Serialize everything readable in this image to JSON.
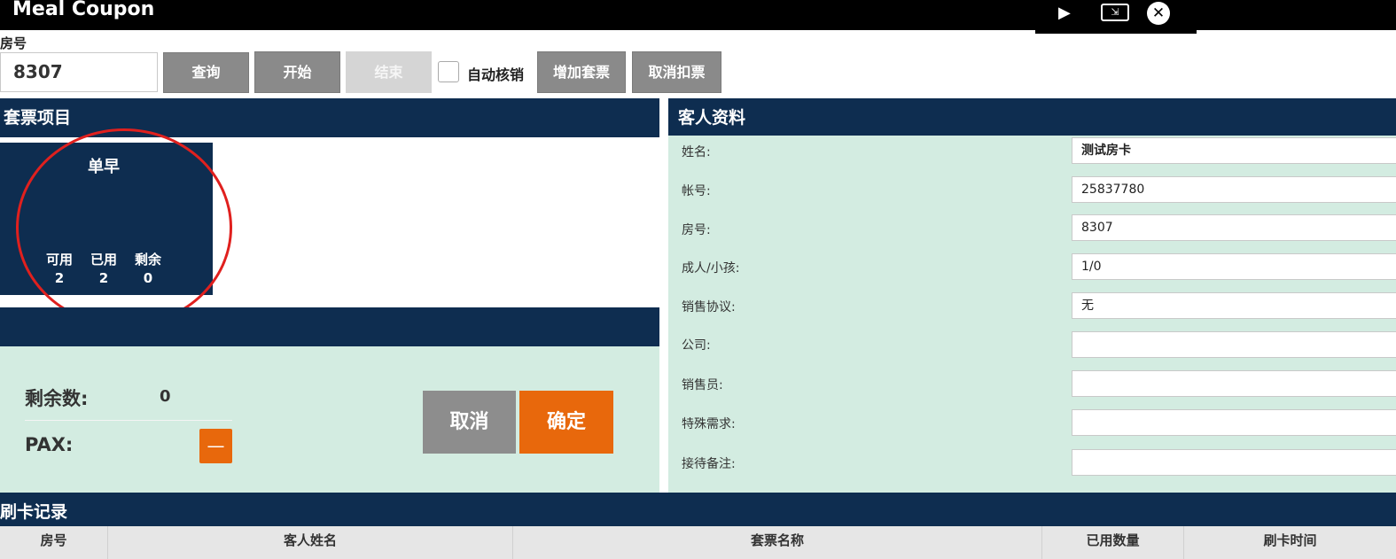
{
  "window": {
    "title": "Meal Coupon",
    "controls": [
      "play-icon",
      "resize-icon",
      "close-icon"
    ]
  },
  "toolbar": {
    "room_label": "房号",
    "room_value": "8307",
    "query_label": "查询",
    "start_label": "开始",
    "end_label": "结束",
    "auto_verify_label": "自动核销",
    "auto_verify_checked": false,
    "add_package_label": "增加套票",
    "cancel_deduct_label": "取消扣票"
  },
  "packages": {
    "header": "套票项目",
    "items": [
      {
        "name": "单早",
        "available_label": "可用",
        "used_label": "已用",
        "remaining_label": "剩余",
        "available": "2",
        "used": "2",
        "remaining": "0"
      }
    ]
  },
  "action": {
    "header": "",
    "remain_label": "剩余数:",
    "remain_value": "0",
    "pax_label": "PAX:",
    "pax_minus": "—",
    "cancel_label": "取消",
    "confirm_label": "确定"
  },
  "guest": {
    "header": "客人资料",
    "fields": [
      {
        "label": "姓名:",
        "value": "测试房卡"
      },
      {
        "label": "帐号:",
        "value": "25837780"
      },
      {
        "label": "房号:",
        "value": "8307"
      },
      {
        "label": "成人/小孩:",
        "value": "1/0"
      },
      {
        "label": "销售协议:",
        "value": "无"
      },
      {
        "label": "公司:",
        "value": ""
      },
      {
        "label": "销售员:",
        "value": ""
      },
      {
        "label": "特殊需求:",
        "value": ""
      },
      {
        "label": "接待备注:",
        "value": ""
      }
    ]
  },
  "swipe_log": {
    "header": "刷卡记录",
    "columns": [
      "房号",
      "客人姓名",
      "套票名称",
      "已用数量",
      "刷卡时间"
    ],
    "rows": []
  },
  "colors": {
    "navy": "#0e2d50",
    "mint": "#d3ece1",
    "orange": "#e8680c",
    "gray_button": "#8a8a8a",
    "annotation_red": "#e0201e"
  }
}
